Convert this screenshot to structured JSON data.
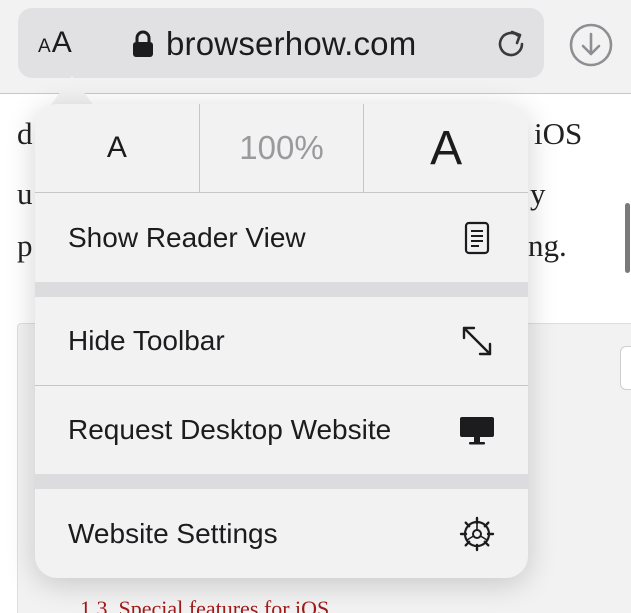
{
  "toolbar": {
    "text_size_small": "A",
    "text_size_large": "A",
    "url": "browserhow.com"
  },
  "background_text": {
    "line1_left": "d",
    "line1_right": "iOS",
    "line2_left": "u",
    "line2_right": "y",
    "line3_left": "p",
    "line3_right": "ng.",
    "toc_link": "1.3. Special features for iOS"
  },
  "popover": {
    "zoom_decrease": "A",
    "zoom_level": "100%",
    "zoom_increase": "A",
    "items": [
      {
        "label": "Show Reader View",
        "icon": "reader-icon"
      },
      {
        "label": "Hide Toolbar",
        "icon": "expand-arrows-icon"
      },
      {
        "label": "Request Desktop Website",
        "icon": "desktop-icon"
      },
      {
        "label": "Website Settings",
        "icon": "gear-icon"
      }
    ]
  },
  "colors": {
    "link_red": "#a11a1a",
    "popover_bg": "#f2f2f2",
    "separator": "#dcdcde"
  }
}
